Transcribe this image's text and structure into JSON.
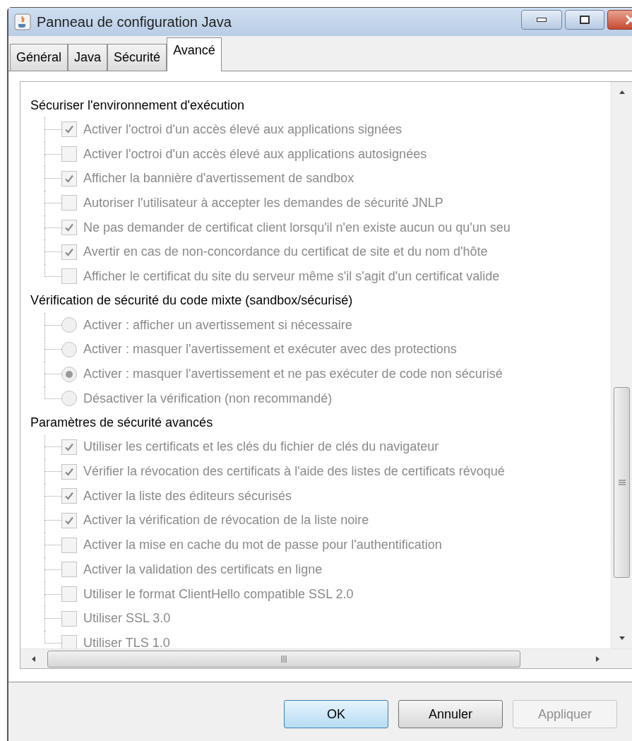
{
  "window": {
    "title": "Panneau de configuration Java"
  },
  "tabs": [
    {
      "label": "Général",
      "selected": false
    },
    {
      "label": "Java",
      "selected": false
    },
    {
      "label": "Sécurité",
      "selected": false
    },
    {
      "label": "Avancé",
      "selected": true
    }
  ],
  "groups": [
    {
      "title": "Sécuriser l'environnement d'exécution",
      "items": [
        {
          "kind": "checkbox",
          "label": "Activer l'octroi d'un accès élevé aux applications signées",
          "checked": true,
          "disabled": true
        },
        {
          "kind": "checkbox",
          "label": "Activer l'octroi d'un accès élevé aux applications autosignées",
          "checked": false,
          "disabled": true
        },
        {
          "kind": "checkbox",
          "label": "Afficher la bannière d'avertissement de sandbox",
          "checked": true,
          "disabled": true
        },
        {
          "kind": "checkbox",
          "label": "Autoriser l'utilisateur à accepter les demandes de sécurité JNLP",
          "checked": false,
          "disabled": true
        },
        {
          "kind": "checkbox",
          "label": "Ne pas demander de certificat client lorsqu'il n'en existe aucun ou qu'un seu",
          "checked": true,
          "disabled": true
        },
        {
          "kind": "checkbox",
          "label": "Avertir en cas de non-concordance du certificat de site et du nom d'hôte",
          "checked": true,
          "disabled": true
        },
        {
          "kind": "checkbox",
          "label": "Afficher le certificat du site du serveur même s'il s'agit d'un certificat valide",
          "checked": false,
          "disabled": true
        }
      ]
    },
    {
      "title": "Vérification de sécurité du code mixte (sandbox/sécurisé)",
      "items": [
        {
          "kind": "radio",
          "label": "Activer : afficher un avertissement si nécessaire",
          "selected": false,
          "disabled": true
        },
        {
          "kind": "radio",
          "label": "Activer : masquer l'avertissement et exécuter avec des protections",
          "selected": false,
          "disabled": true
        },
        {
          "kind": "radio",
          "label": "Activer : masquer l'avertissement et ne pas exécuter de code non sécurisé",
          "selected": true,
          "disabled": true
        },
        {
          "kind": "radio",
          "label": "Désactiver la vérification (non recommandé)",
          "selected": false,
          "disabled": true
        }
      ]
    },
    {
      "title": "Paramètres de sécurité avancés",
      "items": [
        {
          "kind": "checkbox",
          "label": "Utiliser les certificats et les clés du fichier de clés du navigateur",
          "checked": true,
          "disabled": true
        },
        {
          "kind": "checkbox",
          "label": "Vérifier la révocation des certificats à l'aide des listes de certificats révoqué",
          "checked": true,
          "disabled": true
        },
        {
          "kind": "checkbox",
          "label": "Activer la liste des éditeurs sécurisés",
          "checked": true,
          "disabled": true
        },
        {
          "kind": "checkbox",
          "label": "Activer la vérification de révocation de la liste noire",
          "checked": true,
          "disabled": true
        },
        {
          "kind": "checkbox",
          "label": "Activer la mise en cache du mot de passe pour l'authentification",
          "checked": false,
          "disabled": true
        },
        {
          "kind": "checkbox",
          "label": "Activer la validation des certificats en ligne",
          "checked": false,
          "disabled": true
        },
        {
          "kind": "checkbox",
          "label": "Utiliser le format ClientHello compatible SSL 2.0",
          "checked": false,
          "disabled": true
        },
        {
          "kind": "checkbox",
          "label": "Utiliser SSL 3.0",
          "checked": false,
          "disabled": true
        },
        {
          "kind": "checkbox",
          "label": "Utiliser TLS 1.0",
          "checked": false,
          "disabled": true
        }
      ]
    }
  ],
  "buttons": [
    {
      "label": "OK",
      "kind": "default",
      "disabled": false
    },
    {
      "label": "Annuler",
      "kind": "normal",
      "disabled": false
    },
    {
      "label": "Appliquer",
      "kind": "normal",
      "disabled": true
    }
  ]
}
